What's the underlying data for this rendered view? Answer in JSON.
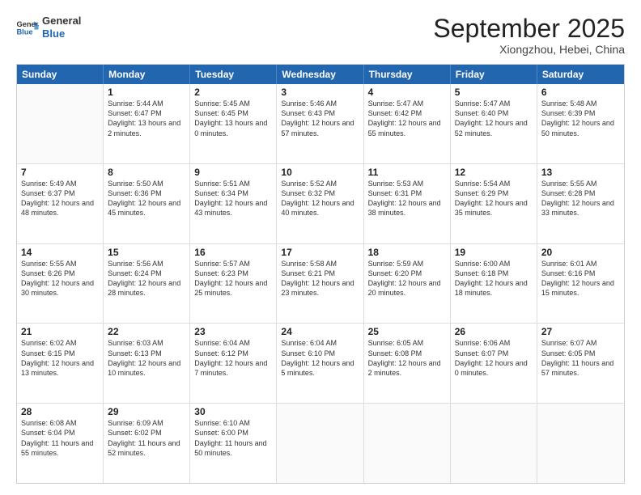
{
  "logo": {
    "line1": "General",
    "line2": "Blue"
  },
  "title": "September 2025",
  "location": "Xiongzhou, Hebei, China",
  "days_of_week": [
    "Sunday",
    "Monday",
    "Tuesday",
    "Wednesday",
    "Thursday",
    "Friday",
    "Saturday"
  ],
  "weeks": [
    [
      {
        "day": "",
        "empty": true
      },
      {
        "day": "1",
        "sunrise": "Sunrise: 5:44 AM",
        "sunset": "Sunset: 6:47 PM",
        "daylight": "Daylight: 13 hours and 2 minutes."
      },
      {
        "day": "2",
        "sunrise": "Sunrise: 5:45 AM",
        "sunset": "Sunset: 6:45 PM",
        "daylight": "Daylight: 13 hours and 0 minutes."
      },
      {
        "day": "3",
        "sunrise": "Sunrise: 5:46 AM",
        "sunset": "Sunset: 6:43 PM",
        "daylight": "Daylight: 12 hours and 57 minutes."
      },
      {
        "day": "4",
        "sunrise": "Sunrise: 5:47 AM",
        "sunset": "Sunset: 6:42 PM",
        "daylight": "Daylight: 12 hours and 55 minutes."
      },
      {
        "day": "5",
        "sunrise": "Sunrise: 5:47 AM",
        "sunset": "Sunset: 6:40 PM",
        "daylight": "Daylight: 12 hours and 52 minutes."
      },
      {
        "day": "6",
        "sunrise": "Sunrise: 5:48 AM",
        "sunset": "Sunset: 6:39 PM",
        "daylight": "Daylight: 12 hours and 50 minutes."
      }
    ],
    [
      {
        "day": "7",
        "sunrise": "Sunrise: 5:49 AM",
        "sunset": "Sunset: 6:37 PM",
        "daylight": "Daylight: 12 hours and 48 minutes."
      },
      {
        "day": "8",
        "sunrise": "Sunrise: 5:50 AM",
        "sunset": "Sunset: 6:36 PM",
        "daylight": "Daylight: 12 hours and 45 minutes."
      },
      {
        "day": "9",
        "sunrise": "Sunrise: 5:51 AM",
        "sunset": "Sunset: 6:34 PM",
        "daylight": "Daylight: 12 hours and 43 minutes."
      },
      {
        "day": "10",
        "sunrise": "Sunrise: 5:52 AM",
        "sunset": "Sunset: 6:32 PM",
        "daylight": "Daylight: 12 hours and 40 minutes."
      },
      {
        "day": "11",
        "sunrise": "Sunrise: 5:53 AM",
        "sunset": "Sunset: 6:31 PM",
        "daylight": "Daylight: 12 hours and 38 minutes."
      },
      {
        "day": "12",
        "sunrise": "Sunrise: 5:54 AM",
        "sunset": "Sunset: 6:29 PM",
        "daylight": "Daylight: 12 hours and 35 minutes."
      },
      {
        "day": "13",
        "sunrise": "Sunrise: 5:55 AM",
        "sunset": "Sunset: 6:28 PM",
        "daylight": "Daylight: 12 hours and 33 minutes."
      }
    ],
    [
      {
        "day": "14",
        "sunrise": "Sunrise: 5:55 AM",
        "sunset": "Sunset: 6:26 PM",
        "daylight": "Daylight: 12 hours and 30 minutes."
      },
      {
        "day": "15",
        "sunrise": "Sunrise: 5:56 AM",
        "sunset": "Sunset: 6:24 PM",
        "daylight": "Daylight: 12 hours and 28 minutes."
      },
      {
        "day": "16",
        "sunrise": "Sunrise: 5:57 AM",
        "sunset": "Sunset: 6:23 PM",
        "daylight": "Daylight: 12 hours and 25 minutes."
      },
      {
        "day": "17",
        "sunrise": "Sunrise: 5:58 AM",
        "sunset": "Sunset: 6:21 PM",
        "daylight": "Daylight: 12 hours and 23 minutes."
      },
      {
        "day": "18",
        "sunrise": "Sunrise: 5:59 AM",
        "sunset": "Sunset: 6:20 PM",
        "daylight": "Daylight: 12 hours and 20 minutes."
      },
      {
        "day": "19",
        "sunrise": "Sunrise: 6:00 AM",
        "sunset": "Sunset: 6:18 PM",
        "daylight": "Daylight: 12 hours and 18 minutes."
      },
      {
        "day": "20",
        "sunrise": "Sunrise: 6:01 AM",
        "sunset": "Sunset: 6:16 PM",
        "daylight": "Daylight: 12 hours and 15 minutes."
      }
    ],
    [
      {
        "day": "21",
        "sunrise": "Sunrise: 6:02 AM",
        "sunset": "Sunset: 6:15 PM",
        "daylight": "Daylight: 12 hours and 13 minutes."
      },
      {
        "day": "22",
        "sunrise": "Sunrise: 6:03 AM",
        "sunset": "Sunset: 6:13 PM",
        "daylight": "Daylight: 12 hours and 10 minutes."
      },
      {
        "day": "23",
        "sunrise": "Sunrise: 6:04 AM",
        "sunset": "Sunset: 6:12 PM",
        "daylight": "Daylight: 12 hours and 7 minutes."
      },
      {
        "day": "24",
        "sunrise": "Sunrise: 6:04 AM",
        "sunset": "Sunset: 6:10 PM",
        "daylight": "Daylight: 12 hours and 5 minutes."
      },
      {
        "day": "25",
        "sunrise": "Sunrise: 6:05 AM",
        "sunset": "Sunset: 6:08 PM",
        "daylight": "Daylight: 12 hours and 2 minutes."
      },
      {
        "day": "26",
        "sunrise": "Sunrise: 6:06 AM",
        "sunset": "Sunset: 6:07 PM",
        "daylight": "Daylight: 12 hours and 0 minutes."
      },
      {
        "day": "27",
        "sunrise": "Sunrise: 6:07 AM",
        "sunset": "Sunset: 6:05 PM",
        "daylight": "Daylight: 11 hours and 57 minutes."
      }
    ],
    [
      {
        "day": "28",
        "sunrise": "Sunrise: 6:08 AM",
        "sunset": "Sunset: 6:04 PM",
        "daylight": "Daylight: 11 hours and 55 minutes."
      },
      {
        "day": "29",
        "sunrise": "Sunrise: 6:09 AM",
        "sunset": "Sunset: 6:02 PM",
        "daylight": "Daylight: 11 hours and 52 minutes."
      },
      {
        "day": "30",
        "sunrise": "Sunrise: 6:10 AM",
        "sunset": "Sunset: 6:00 PM",
        "daylight": "Daylight: 11 hours and 50 minutes."
      },
      {
        "day": "",
        "empty": true
      },
      {
        "day": "",
        "empty": true
      },
      {
        "day": "",
        "empty": true
      },
      {
        "day": "",
        "empty": true
      }
    ]
  ]
}
